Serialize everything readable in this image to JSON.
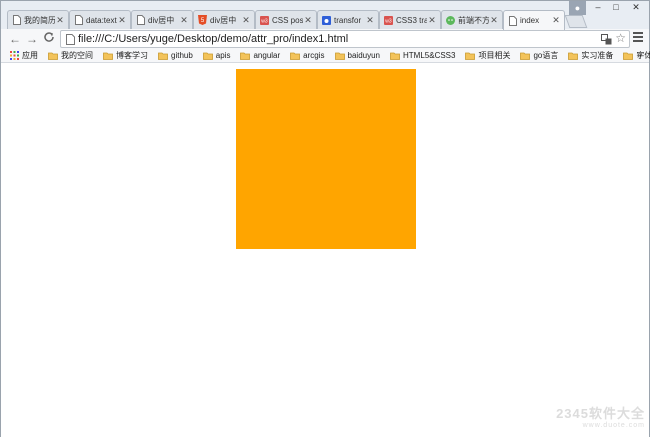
{
  "browser": {
    "tabs": [
      {
        "label": "我的简历",
        "icon": "page-icon",
        "active": false
      },
      {
        "label": "data:text",
        "icon": "page-icon",
        "active": false
      },
      {
        "label": "div居中",
        "icon": "page-icon",
        "active": false
      },
      {
        "label": "div居中",
        "icon": "html5-icon",
        "active": false
      },
      {
        "label": "CSS posi",
        "icon": "w3-icon",
        "active": false
      },
      {
        "label": "transfor",
        "icon": "baidu-icon",
        "active": false
      },
      {
        "label": "CSS3 tra",
        "icon": "w3-icon",
        "active": false
      },
      {
        "label": "前端不方",
        "icon": "green-icon",
        "active": false
      },
      {
        "label": "index",
        "icon": "page-icon",
        "active": true
      }
    ],
    "tab_close_glyph": "✕",
    "window_controls": {
      "minimize": "–",
      "maximize": "□",
      "close": "✕"
    },
    "nav": {
      "back": "←",
      "forward": "→",
      "reload": "C"
    },
    "address": {
      "url": "file:///C:/Users/yuge/Desktop/demo/attr_pro/index1.html"
    },
    "bookmarks": {
      "apps_label": "应用",
      "items": [
        "我的空间",
        "博客学习",
        "github",
        "apis",
        "angular",
        "arcgis",
        "baiduyun",
        "HTML5&CSS3",
        "项目相关",
        "go语言",
        "实习准备",
        "字体&颜色"
      ],
      "more": "»"
    }
  },
  "page": {
    "box_color": "#FFA500"
  },
  "watermark": {
    "line1": "2345软件大全",
    "line2": "www.duote.com"
  }
}
